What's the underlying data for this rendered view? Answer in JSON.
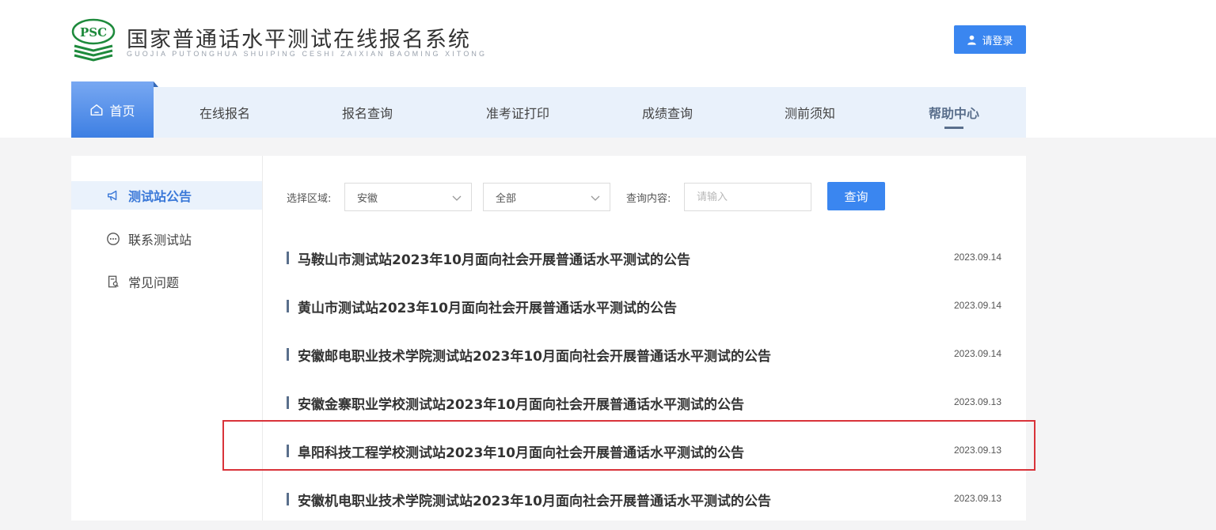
{
  "header": {
    "logo_text": "PSC",
    "title": "国家普通话水平测试在线报名系统",
    "subtitle": "GUOJIA PUTONGHUA SHUIPING CESHI ZAIXIAN BAOMING XITONG",
    "login_label": "请登录"
  },
  "nav": {
    "home": "首页",
    "items": [
      "在线报名",
      "报名查询",
      "准考证打印",
      "成绩查询",
      "测前须知",
      "帮助中心"
    ],
    "active": "帮助中心"
  },
  "sidebar": {
    "items": [
      {
        "label": "测试站公告",
        "icon": "megaphone-icon",
        "active": true
      },
      {
        "label": "联系测试站",
        "icon": "chat-bubble-icon",
        "active": false
      },
      {
        "label": "常见问题",
        "icon": "document-search-icon",
        "active": false
      }
    ]
  },
  "filters": {
    "region_label": "选择区域:",
    "province_value": "安徽",
    "city_value": "全部",
    "query_label": "查询内容:",
    "query_placeholder": "请输入",
    "search_label": "查询"
  },
  "notices": [
    {
      "title": "马鞍山市测试站2023年10月面向社会开展普通话水平测试的公告",
      "date": "2023.09.14"
    },
    {
      "title": "黄山市测试站2023年10月面向社会开展普通话水平测试的公告",
      "date": "2023.09.14"
    },
    {
      "title": "安徽邮电职业技术学院测试站2023年10月面向社会开展普通话水平测试的公告",
      "date": "2023.09.14"
    },
    {
      "title": "安徽金寨职业学校测试站2023年10月面向社会开展普通话水平测试的公告",
      "date": "2023.09.13"
    },
    {
      "title": "阜阳科技工程学校测试站2023年10月面向社会开展普通话水平测试的公告",
      "date": "2023.09.13"
    },
    {
      "title": "安徽机电职业技术学院测试站2023年10月面向社会开展普通话水平测试的公告",
      "date": "2023.09.13"
    }
  ],
  "colors": {
    "accent": "#3a86f0",
    "nav_bg": "#e9f1fb",
    "active_nav": "#5a6f8c",
    "highlight": "#d9333a",
    "logo_green": "#1e8a3c"
  }
}
